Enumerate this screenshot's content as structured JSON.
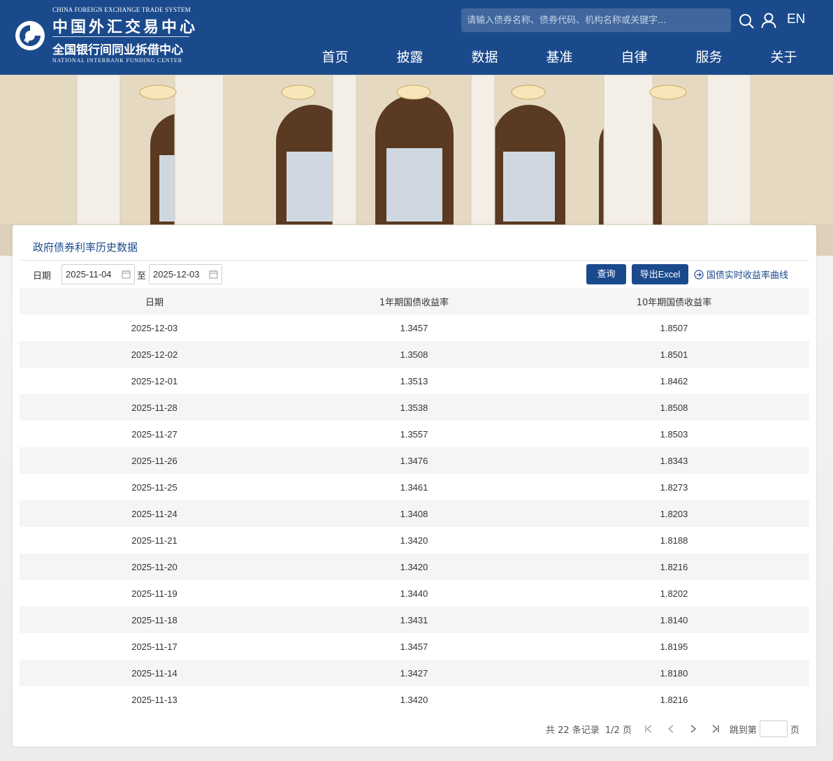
{
  "header": {
    "logo": {
      "en_top": "CHINA FOREIGN EXCHANGE TRADE SYSTEM",
      "cn_main": "中国外汇交易中心",
      "cn_sub": "全国银行间同业拆借中心",
      "en_bottom": "NATIONAL INTERBANK FUNDING CENTER"
    },
    "search_placeholder": "请输入债券名称、债券代码、机构名称或关键字...",
    "search_icon": "search-icon",
    "user_icon": "user-icon",
    "lang": "EN",
    "nav": [
      "首页",
      "披露",
      "数据",
      "基准",
      "自律",
      "服务",
      "关于"
    ]
  },
  "card": {
    "title": "政府债券利率历史数据",
    "filter": {
      "label": "日期",
      "start": "2025-11-04",
      "to": "至",
      "end": "2025-12-03",
      "query_button": "查询",
      "export_button": "导出Excel",
      "curve_link": "国债实时收益率曲线"
    },
    "table": {
      "columns": [
        "日期",
        "1年期国债收益率",
        "10年期国债收益率"
      ],
      "rows": [
        [
          "2025-12-03",
          "1.3457",
          "1.8507"
        ],
        [
          "2025-12-02",
          "1.3508",
          "1.8501"
        ],
        [
          "2025-12-01",
          "1.3513",
          "1.8462"
        ],
        [
          "2025-11-28",
          "1.3538",
          "1.8508"
        ],
        [
          "2025-11-27",
          "1.3557",
          "1.8503"
        ],
        [
          "2025-11-26",
          "1.3476",
          "1.8343"
        ],
        [
          "2025-11-25",
          "1.3461",
          "1.8273"
        ],
        [
          "2025-11-24",
          "1.3408",
          "1.8203"
        ],
        [
          "2025-11-21",
          "1.3420",
          "1.8188"
        ],
        [
          "2025-11-20",
          "1.3420",
          "1.8216"
        ],
        [
          "2025-11-19",
          "1.3440",
          "1.8202"
        ],
        [
          "2025-11-18",
          "1.3431",
          "1.8140"
        ],
        [
          "2025-11-17",
          "1.3457",
          "1.8195"
        ],
        [
          "2025-11-14",
          "1.3427",
          "1.8180"
        ],
        [
          "2025-11-13",
          "1.3420",
          "1.8216"
        ]
      ]
    },
    "pagination": {
      "total": "共 22 条记录",
      "page": "1/2 页",
      "jump_label": "跳到第",
      "jump_suffix": "页",
      "jump_value": ""
    }
  },
  "colors": {
    "brand": "#1b4a8c",
    "row_alt": "#f5f5f5"
  }
}
